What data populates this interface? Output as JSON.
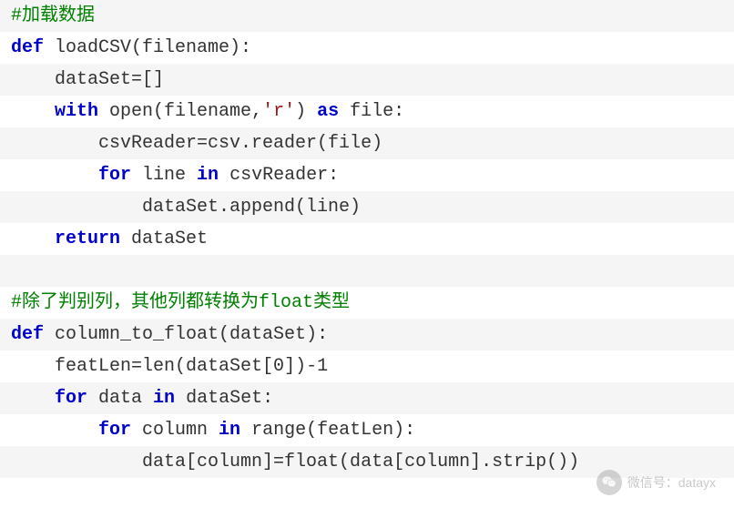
{
  "code": {
    "lines": [
      {
        "tokens": [
          {
            "cls": "comment",
            "text": "#加载数据"
          }
        ]
      },
      {
        "tokens": [
          {
            "cls": "keyword",
            "text": "def"
          },
          {
            "cls": "ident",
            "text": " loadCSV(filename):"
          }
        ]
      },
      {
        "tokens": [
          {
            "cls": "ident",
            "text": "    dataSet=[]"
          }
        ]
      },
      {
        "tokens": [
          {
            "cls": "ident",
            "text": "    "
          },
          {
            "cls": "keyword",
            "text": "with"
          },
          {
            "cls": "ident",
            "text": " open(filename,"
          },
          {
            "cls": "string",
            "text": "'r'"
          },
          {
            "cls": "ident",
            "text": ") "
          },
          {
            "cls": "keyword",
            "text": "as"
          },
          {
            "cls": "ident",
            "text": " file:"
          }
        ]
      },
      {
        "tokens": [
          {
            "cls": "ident",
            "text": "        csvReader=csv.reader(file)"
          }
        ]
      },
      {
        "tokens": [
          {
            "cls": "ident",
            "text": "        "
          },
          {
            "cls": "keyword",
            "text": "for"
          },
          {
            "cls": "ident",
            "text": " line "
          },
          {
            "cls": "keyword",
            "text": "in"
          },
          {
            "cls": "ident",
            "text": " csvReader:"
          }
        ]
      },
      {
        "tokens": [
          {
            "cls": "ident",
            "text": "            dataSet.append(line)"
          }
        ]
      },
      {
        "tokens": [
          {
            "cls": "ident",
            "text": "    "
          },
          {
            "cls": "keyword",
            "text": "return"
          },
          {
            "cls": "ident",
            "text": " dataSet"
          }
        ]
      },
      {
        "tokens": [
          {
            "cls": "ident",
            "text": ""
          }
        ]
      },
      {
        "tokens": [
          {
            "cls": "comment",
            "text": "#除了判别列，其他列都转换为float类型"
          }
        ]
      },
      {
        "tokens": [
          {
            "cls": "keyword",
            "text": "def"
          },
          {
            "cls": "ident",
            "text": " column_to_float(dataSet):"
          }
        ]
      },
      {
        "tokens": [
          {
            "cls": "ident",
            "text": "    featLen=len(dataSet["
          },
          {
            "cls": "number",
            "text": "0"
          },
          {
            "cls": "ident",
            "text": "])-"
          },
          {
            "cls": "number",
            "text": "1"
          }
        ]
      },
      {
        "tokens": [
          {
            "cls": "ident",
            "text": "    "
          },
          {
            "cls": "keyword",
            "text": "for"
          },
          {
            "cls": "ident",
            "text": " data "
          },
          {
            "cls": "keyword",
            "text": "in"
          },
          {
            "cls": "ident",
            "text": " dataSet:"
          }
        ]
      },
      {
        "tokens": [
          {
            "cls": "ident",
            "text": "        "
          },
          {
            "cls": "keyword",
            "text": "for"
          },
          {
            "cls": "ident",
            "text": " column "
          },
          {
            "cls": "keyword",
            "text": "in"
          },
          {
            "cls": "ident",
            "text": " range(featLen):"
          }
        ]
      },
      {
        "tokens": [
          {
            "cls": "ident",
            "text": "            data[column]=float(data[column].strip())"
          }
        ]
      }
    ]
  },
  "watermark": {
    "label": "微信号：datayx"
  }
}
